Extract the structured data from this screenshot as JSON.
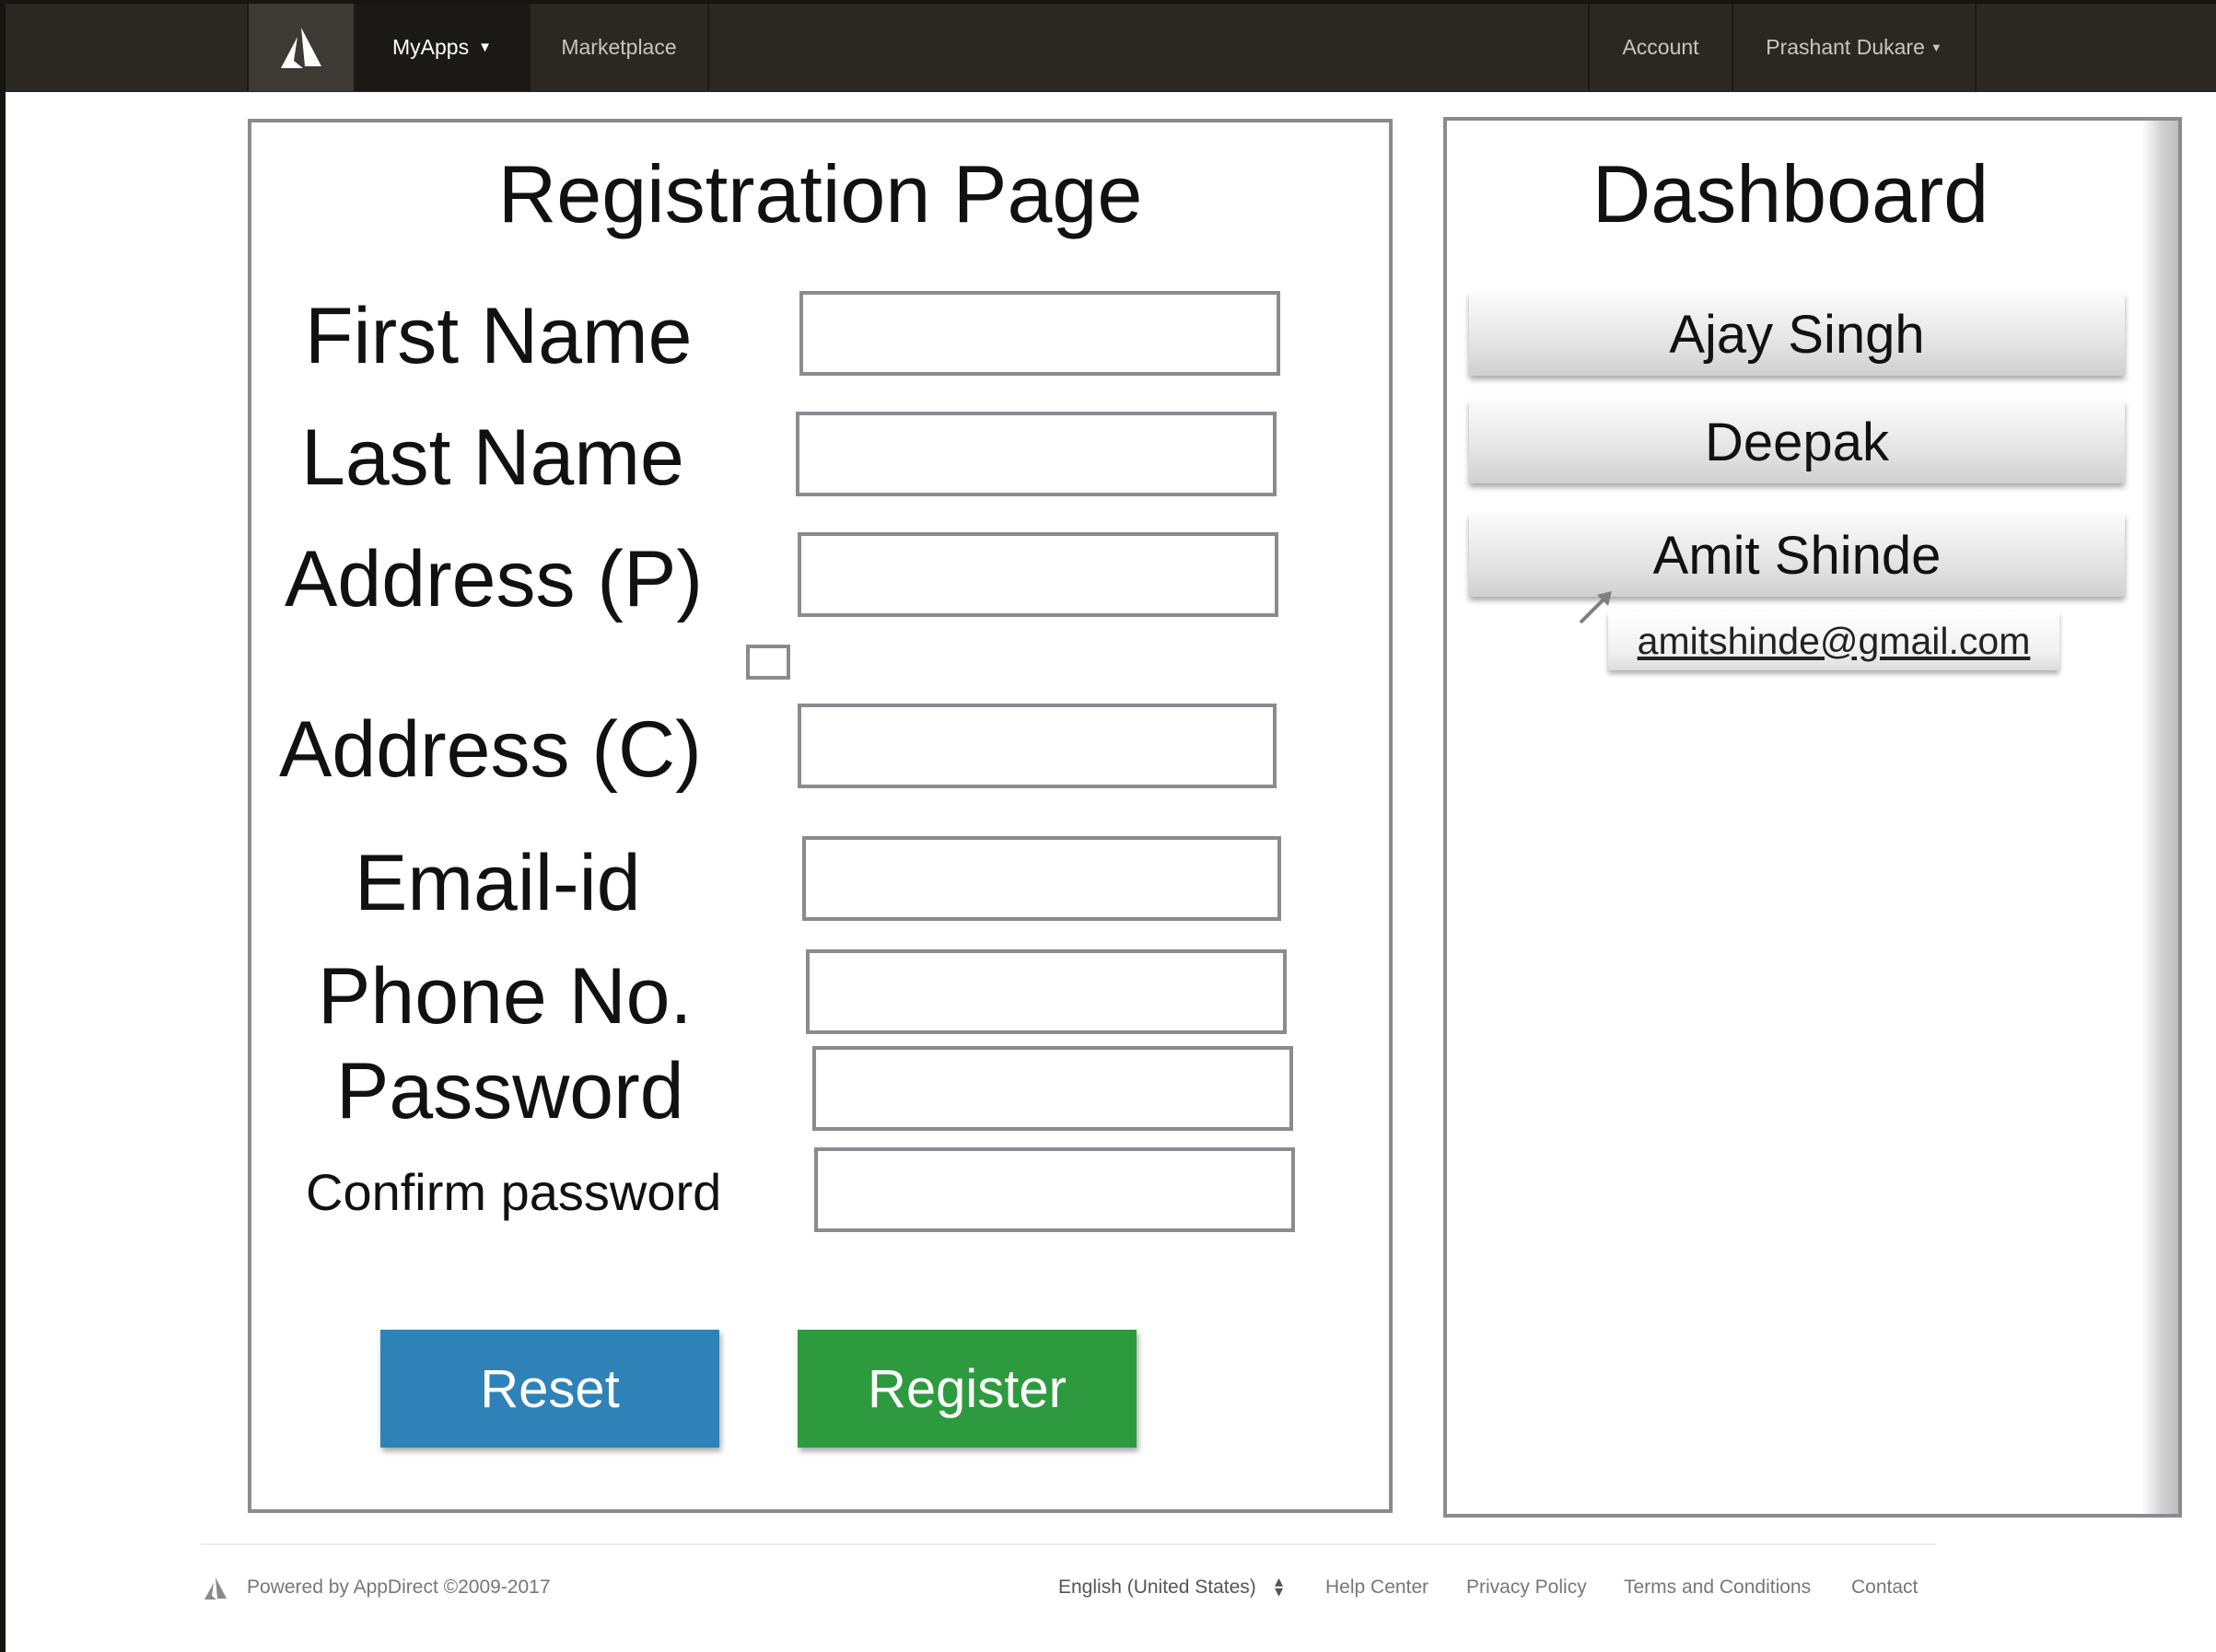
{
  "nav": {
    "logo_icon": "appdirect-logo-icon",
    "myapps_label": "MyApps",
    "myapps_caret": "▼",
    "marketplace_label": "Marketplace",
    "account_label": "Account",
    "user_label": "Prashant Dukare",
    "user_caret": "▼"
  },
  "registration": {
    "title": "Registration Page",
    "fields": {
      "first_name": {
        "label": "First Name",
        "value": ""
      },
      "last_name": {
        "label": "Last Name",
        "value": ""
      },
      "address_p": {
        "label": "Address (P)",
        "value": ""
      },
      "address_c": {
        "label": "Address (C)",
        "value": ""
      },
      "email": {
        "label": "Email-id",
        "value": ""
      },
      "phone": {
        "label": "Phone No.",
        "value": ""
      },
      "password": {
        "label": "Password",
        "value": ""
      },
      "confirm_password": {
        "label": "Confirm password",
        "value": ""
      }
    },
    "same_address_checked": false,
    "reset_label": "Reset",
    "register_label": "Register",
    "colors": {
      "reset": "#2f82b8",
      "register": "#2e9a3f"
    }
  },
  "dashboard": {
    "title": "Dashboard",
    "users": [
      {
        "name": "Ajay Singh"
      },
      {
        "name": "Deepak"
      },
      {
        "name": "Amit Shinde"
      }
    ],
    "tooltip_email": "amitshinde@gmail.com",
    "pointer_icon": "arrow-pointer-icon"
  },
  "footer": {
    "powered_by": "Powered by AppDirect ©2009-2017",
    "language": "English (United States)",
    "language_icon": "sort-arrows-icon",
    "links": [
      "Help Center",
      "Privacy Policy",
      "Terms and Conditions",
      "Contact"
    ]
  }
}
